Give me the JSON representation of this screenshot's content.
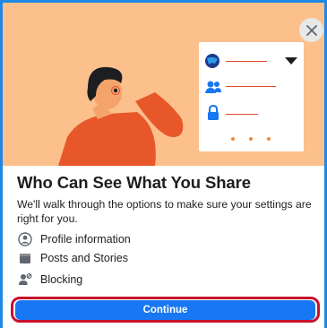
{
  "dialog": {
    "close_icon": "close-icon",
    "title": "Who Can See What You Share",
    "description": "We'll walk through the options to make sure your settings are right for you.",
    "items": [
      {
        "label": "Profile information",
        "icon": "user-circle-icon"
      },
      {
        "label": "Posts and Stories",
        "icon": "posts-icon"
      },
      {
        "label": "Blocking",
        "icon": "blocking-icon"
      }
    ],
    "continue_label": "Continue"
  },
  "colors": {
    "hero_bg": "#fcc08c",
    "primary": "#1877f2",
    "highlight_border": "#c8102e",
    "frame_border": "#1e88e5"
  }
}
